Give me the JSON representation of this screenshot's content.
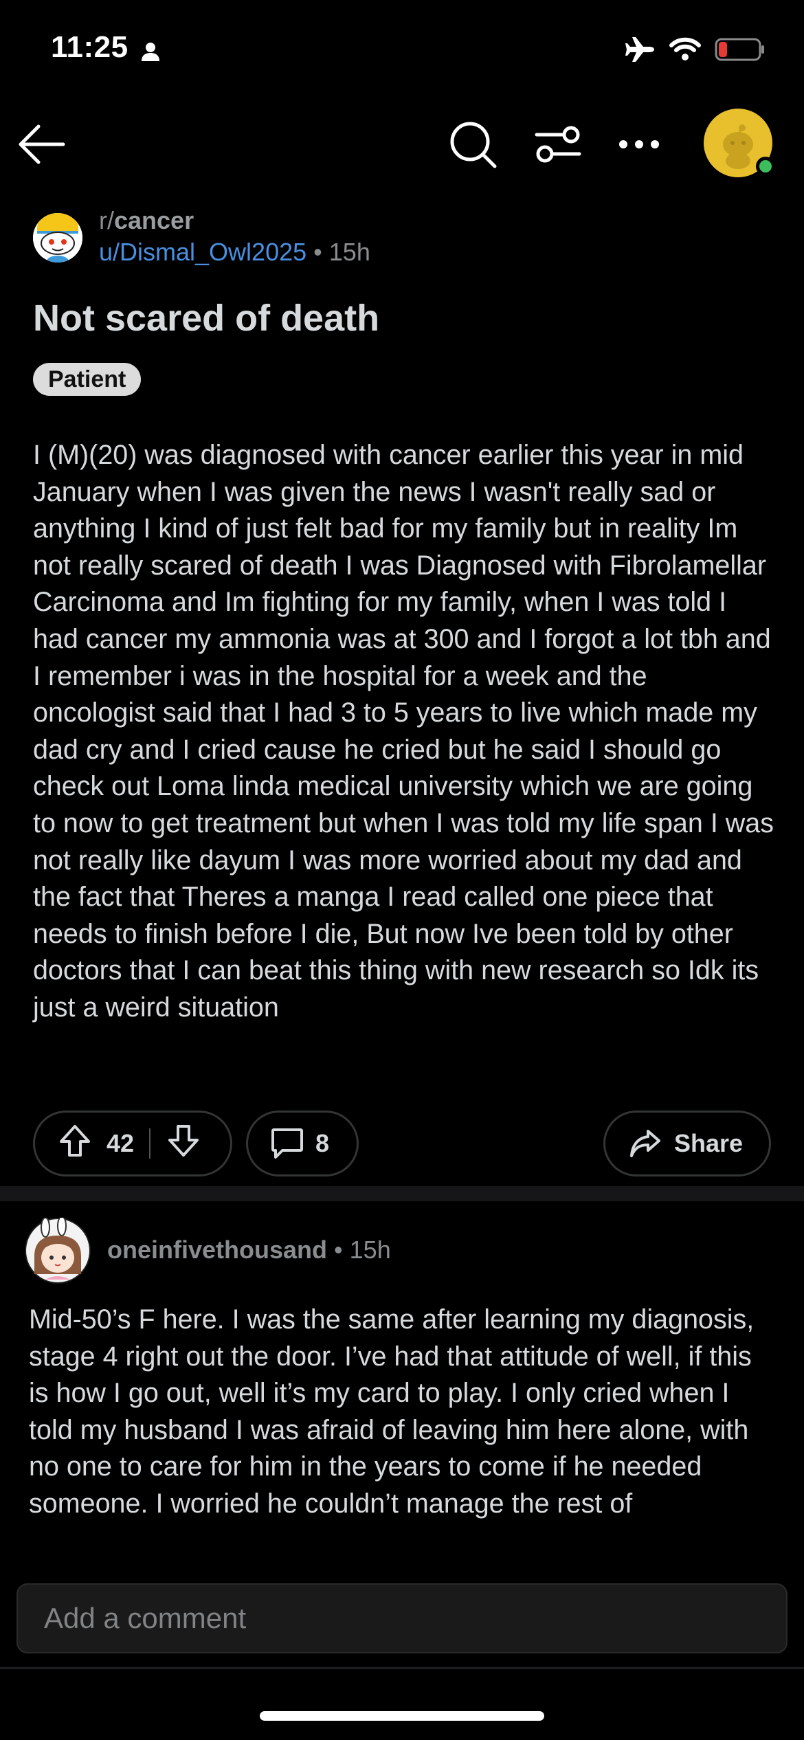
{
  "status_bar": {
    "time": "11:25"
  },
  "post": {
    "subreddit_prefix": "r/",
    "subreddit_name": "cancer",
    "author": "u/Dismal_Owl2025",
    "separator": "•",
    "age": "15h",
    "title": "Not scared of death",
    "flair": "Patient",
    "body": "I (M)(20) was diagnosed with cancer earlier this year in mid January when I was given the news I wasn't really sad or anything I kind of just felt bad for my family but in reality Im not really scared of death I was Diagnosed with Fibrolamellar Carcinoma and Im fighting for my family, when I was told I had cancer my ammonia was at 300 and I forgot a lot tbh and I remember i was in the hospital for a week and the oncologist said that I had 3 to 5 years to live which made my dad cry and I cried cause he cried but he said I should go check out Loma linda medical university which we are going to now to get treatment but when I was told my life span I was not really like dayum I was more worried about my dad and the fact that Theres a manga I read called one piece that needs to finish before I die, But now Ive been told by other doctors that I can beat this thing with new research so Idk its just a weird situation",
    "vote_count": "42",
    "comment_count": "8",
    "share_label": "Share"
  },
  "comment": {
    "author": "oneinfivethousand",
    "separator": "•",
    "age": "15h",
    "body": "Mid-50’s F here. I was the same after learning my diagnosis, stage 4 right out the door. I’ve had that attitude of well, if this is how I go out, well it’s my card to play. I only cried when I told my husband I was afraid of leaving him here alone, with no one to care for him in the years to come if he needed someone. I worried he couldn’t manage the rest of"
  },
  "composer": {
    "placeholder": "Add a comment"
  },
  "icons": {
    "back": "arrow-left-icon",
    "search": "search-icon",
    "filter": "sort-sliders-icon",
    "more": "more-horizontal-icon",
    "upvote": "upvote-arrow-icon",
    "downvote": "downvote-arrow-icon",
    "comment": "comment-bubble-icon",
    "share": "share-arrow-icon"
  },
  "colors": {
    "background": "#000000",
    "text": "#D7DADC",
    "muted": "#8A8D90",
    "author_link": "#4A8FE0",
    "flair_bg": "#DCDCDC",
    "user_avatar": "#E8C02E",
    "online": "#3BBE5B",
    "battery_low": "#E53935"
  }
}
